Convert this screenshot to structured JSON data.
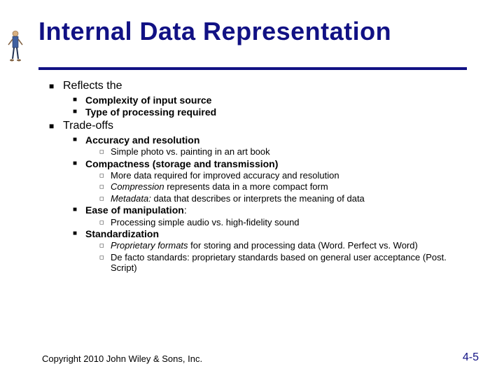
{
  "title": "Internal Data Representation",
  "content": {
    "l1_reflects": "Reflects the",
    "l2_complexity": "Complexity of input source",
    "l2_type": "Type of processing required",
    "l1_tradeoffs": "Trade-offs",
    "l2_accuracy": "Accuracy and resolution",
    "l3_photo": "Simple photo vs. painting in an art book",
    "l2_compactness": "Compactness (storage and transmission)",
    "l3_moredata": "More data required for improved accuracy and resolution",
    "l3_compression_em": "Compression",
    "l3_compression_rest": " represents data in a more compact form",
    "l3_metadata_em": "Metadata:",
    "l3_metadata_rest": " data that describes or interprets the meaning of data",
    "l2_ease": "Ease of manipulation",
    "l2_ease_colon": ":",
    "l3_audio": "Processing simple audio vs. high-fidelity sound",
    "l2_standardization": "Standardization",
    "l3_proprietary_em": "Proprietary formats",
    "l3_proprietary_rest": " for storing and processing data (Word. Perfect vs. Word)",
    "l3_defacto": "De facto standards:  proprietary standards based on general user acceptance (Post. Script)"
  },
  "footer": {
    "copyright": "Copyright 2010 John Wiley & Sons, Inc.",
    "page": "4-5"
  }
}
